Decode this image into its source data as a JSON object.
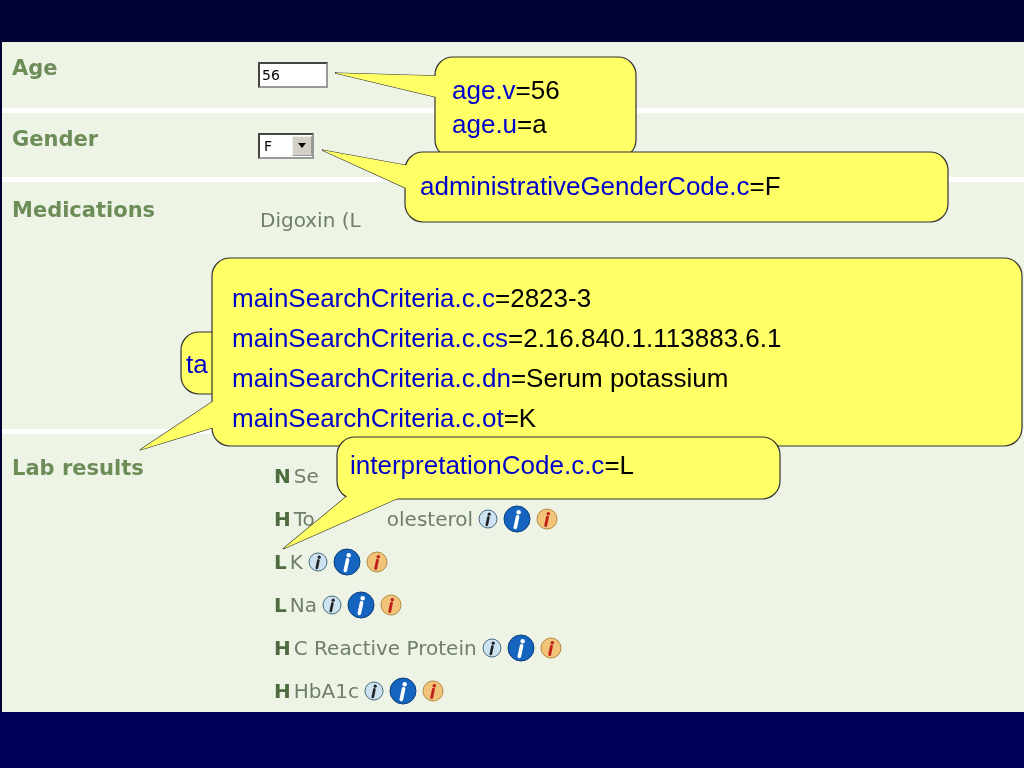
{
  "form": {
    "rows": [
      {
        "kind": "field",
        "label": "Age",
        "value": "56"
      },
      {
        "kind": "select",
        "label": "Gender",
        "value": "F"
      },
      {
        "kind": "medications",
        "label": "Medications",
        "items": [
          {
            "name": "Digoxin (L"
          }
        ]
      },
      {
        "kind": "labs",
        "label": "Lab results",
        "items": [
          {
            "code": "N",
            "name": "Se",
            "info_icons": false
          },
          {
            "code": "H",
            "name": "To",
            "name_after_gap": "olesterol",
            "info_icons": true
          },
          {
            "code": "L",
            "name": "K",
            "info_icons": true
          },
          {
            "code": "L",
            "name": "Na",
            "info_icons": true
          },
          {
            "code": "H",
            "name": "C Reactive Protein",
            "info_icons": true
          },
          {
            "code": "H",
            "name": "HbA1c",
            "info_icons": true
          }
        ]
      }
    ]
  },
  "callouts": [
    {
      "lines": [
        {
          "key": "age.v",
          "value": "=56"
        },
        {
          "key": "age.u",
          "value": "=a"
        }
      ]
    },
    {
      "lines": [
        {
          "key": "administrativeGenderCode.c",
          "value": "=F"
        }
      ]
    },
    {
      "lines": [
        {
          "key": "ta"
        }
      ]
    },
    {
      "lines": [
        {
          "key": "mainSearchCriteria.c.c",
          "value": "=2823-3"
        },
        {
          "key": "mainSearchCriteria.c.cs",
          "value": "=2.16.840.1.113883.6.1"
        },
        {
          "key": "mainSearchCriteria.c.dn",
          "value": "=Serum potassium"
        },
        {
          "key": "mainSearchCriteria.c.ot",
          "value": "=K"
        }
      ]
    },
    {
      "lines": [
        {
          "key": "interpretationCode.c.c",
          "value": "=L"
        }
      ]
    }
  ]
}
